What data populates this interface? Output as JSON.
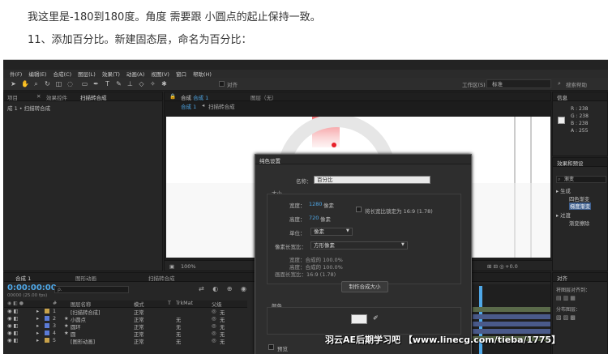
{
  "article": {
    "line1": "我这里是-180到180度。角度 需要跟 小圆点的起止保持一致。",
    "line2": "11、添加百分比。新建固态层，命名为百分比："
  },
  "ae": {
    "menu": [
      "件(F)",
      "编辑(E)",
      "合成(C)",
      "图层(L)",
      "效果(T)",
      "动画(A)",
      "视图(V)",
      "窗口",
      "帮助(H)"
    ],
    "toolbar": {
      "snap_label": "对齐",
      "workspace_label": "工作区(S)",
      "workspace_value": "标准",
      "search_placeholder": "搜索帮助"
    },
    "left_panel": {
      "tab1": "项目",
      "tab2": "效果控件",
      "tab2_target": "扫描转合成",
      "breadcrumb": "成 1 • 扫描转合成"
    },
    "viewer": {
      "tab_comp": "合成",
      "tab_comp_name": "合成 1",
      "tab_layer": "图层（无）",
      "sub_tab1": "合成 1",
      "sub_tab2": "扫描转合成",
      "zoom": "100%",
      "exposure": "+0.0"
    },
    "info_panel": {
      "tab": "信息",
      "r": "R : 238",
      "g": "G : 238",
      "b": "B : 238",
      "a": "A : 255"
    },
    "effects_panel": {
      "tab": "效果和预设",
      "search_value": "渐变",
      "groups": [
        {
          "name": "▸ 生成",
          "items": [
            "四色渐变",
            "梯度渐变"
          ]
        },
        {
          "name": "▸ 过渡",
          "items": [
            "渐变擦除"
          ]
        }
      ],
      "highlight_index": 1
    },
    "right_bottom": {
      "tab": "对齐",
      "label1": "将图层对齐到：",
      "label2": "分布图层："
    },
    "timeline": {
      "tabs": [
        "合成 1",
        "图形动画",
        "扫描转合成"
      ],
      "timecode": "0:00:00:00",
      "fps": "00000 (25.00 fps)",
      "search_placeholder": "ρ.",
      "headers": {
        "num": "#",
        "name": "图层名称",
        "mode": "模式",
        "t": "T",
        "trkmat": "TrkMat",
        "parent": "父级"
      },
      "rows": [
        {
          "num": "1",
          "name": "[扫描转合成]",
          "mode": "正常",
          "trkmat": "",
          "parent": "无",
          "color": "#c8a24a"
        },
        {
          "num": "2",
          "name": "小圆点",
          "mode": "正常",
          "trkmat": "无",
          "parent": "无",
          "color": "#5b7bd6"
        },
        {
          "num": "3",
          "name": "圆环",
          "mode": "正常",
          "trkmat": "无",
          "parent": "无",
          "color": "#5b7bd6"
        },
        {
          "num": "4",
          "name": "圆",
          "mode": "正常",
          "trkmat": "无",
          "parent": "无",
          "color": "#5b7bd6"
        },
        {
          "num": "5",
          "name": "[图形动画]",
          "mode": "正常",
          "trkmat": "无",
          "parent": "无",
          "color": "#c8a24a"
        }
      ]
    },
    "dialog": {
      "title": "纯色设置",
      "name_label": "名称：",
      "name_value": "百分比",
      "size_group": "大小",
      "width_label": "宽度：",
      "width_value": "1280",
      "width_unit": "像素",
      "lock_label": "将长宽比锁定为 16:9 (1.78)",
      "height_label": "高度：",
      "height_value": "720",
      "height_unit": "像素",
      "unit_label": "单位：",
      "unit_value": "像素",
      "par_label": "像素长宽比：",
      "par_value": "方形像素",
      "info1": "宽度：合成的 100.0%",
      "info2": "高度：合成的 100.0%",
      "info3": "画面长宽比：16:9 (1.78)",
      "make_comp_size": "制作合成大小",
      "color_group": "颜色",
      "preview_label": "预览"
    }
  },
  "watermark": "羽云AE后期学习吧 【www.linecg.com/tieba/1775】",
  "colors": {
    "ae_bg": "#232323",
    "accent_blue": "#4fa8e8",
    "red_dot": "#e8202a",
    "highlight": "#3e5f8e"
  }
}
